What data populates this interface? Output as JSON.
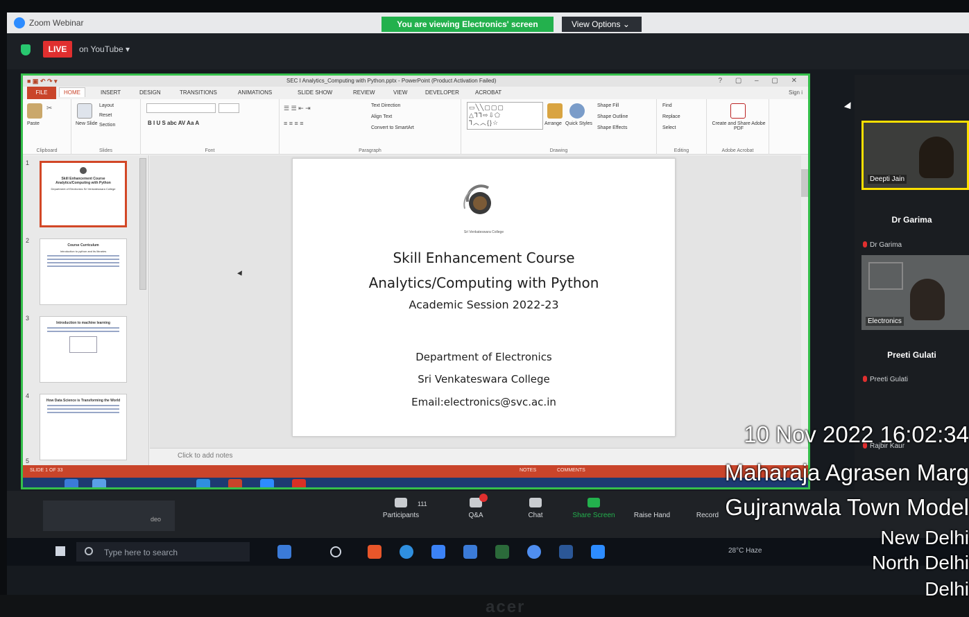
{
  "zoom": {
    "window_title": "Zoom Webinar",
    "viewing_banner": "You are viewing Electronics' screen",
    "view_options": "View Options ⌄",
    "live_badge": "LIVE",
    "live_text": "on YouTube ▾"
  },
  "powerpoint": {
    "title": "SEC I Analytics_Computing with Python.pptx - PowerPoint (Product Activation Failed)",
    "window_controls": "? ▢ – ▢ ✕",
    "sign_in": "Sign i",
    "tabs": [
      "FILE",
      "HOME",
      "INSERT",
      "DESIGN",
      "TRANSITIONS",
      "ANIMATIONS",
      "SLIDE SHOW",
      "REVIEW",
      "VIEW",
      "DEVELOPER",
      "ACROBAT"
    ],
    "ribbon": {
      "clipboard": "Clipboard",
      "paste": "Paste",
      "slides": "Slides",
      "new_slide": "New Slide",
      "layout": "Layout",
      "reset": "Reset",
      "section": "Section",
      "font": "Font",
      "paragraph": "Paragraph",
      "text_direction": "Text Direction",
      "align_text": "Align Text",
      "convert_smartart": "Convert to SmartArt",
      "drawing": "Drawing",
      "arrange": "Arrange",
      "quick_styles": "Quick Styles",
      "shape_fill": "Shape Fill",
      "shape_outline": "Shape Outline",
      "shape_effects": "Shape Effects",
      "editing": "Editing",
      "find": "Find",
      "replace": "Replace",
      "select": "Select",
      "adobe_acrobat": "Adobe Acrobat",
      "create_share": "Create and Share Adobe PDF"
    },
    "thumbnails": [
      {
        "num": "1",
        "title": "Skill Enhancement Course Analytics/Computing with Python",
        "sub": "Department of Electronics Sri Venkateswara College"
      },
      {
        "num": "2",
        "title": "Course Curriculum",
        "sub": "Introduction to python and its libraries"
      },
      {
        "num": "3",
        "title": "Introduction to machine learning",
        "sub": ""
      },
      {
        "num": "4",
        "title": "How Data Science is Transforming the World",
        "sub": ""
      },
      {
        "num": "5",
        "title": "",
        "sub": ""
      }
    ],
    "slide": {
      "college_small": "Sri Venkateswara College",
      "line1": "Skill Enhancement Course",
      "line2": "Analytics/Computing with Python",
      "line3": "Academic Session 2022-23",
      "line4": "Department of Electronics",
      "line5": "Sri Venkateswara College",
      "line6": "Email:electronics@svc.ac.in"
    },
    "notes_placeholder": "Click to add notes",
    "status_left": "SLIDE 1 OF 33",
    "status_notes": "NOTES",
    "status_comments": "COMMENTS"
  },
  "controls": {
    "participants_label": "Participants",
    "participants_count": "111",
    "qa_label": "Q&A",
    "chat_label": "Chat",
    "share_label": "Share Screen",
    "raise_label": "Raise Hand",
    "record_label": "Record",
    "video_label": "deo"
  },
  "taskbar": {
    "search_placeholder": "Type here to search",
    "weather": "28°C Haze"
  },
  "panel": {
    "video1_name": "Deepti Jain",
    "p1_title": "Dr Garima",
    "p1_small": "Dr Garima",
    "video2_name": "Electronics",
    "p2_title": "Preeti Gulati",
    "p2_small": "Preeti Gulati",
    "p3_small": "Rajbir Kaur"
  },
  "stamp": {
    "datetime": "10 Nov 2022 16:02:34",
    "line2": "Maharaja Agrasen Marg",
    "line3": "Gujranwala Town Model",
    "line4": "New Delhi",
    "line5": "North Delhi",
    "line6": "Delhi"
  },
  "colors": {
    "zoom_green": "#23b14d",
    "live_red": "#e02f2f",
    "ppt_orange": "#c9442a",
    "active_speaker": "#ffe000"
  }
}
